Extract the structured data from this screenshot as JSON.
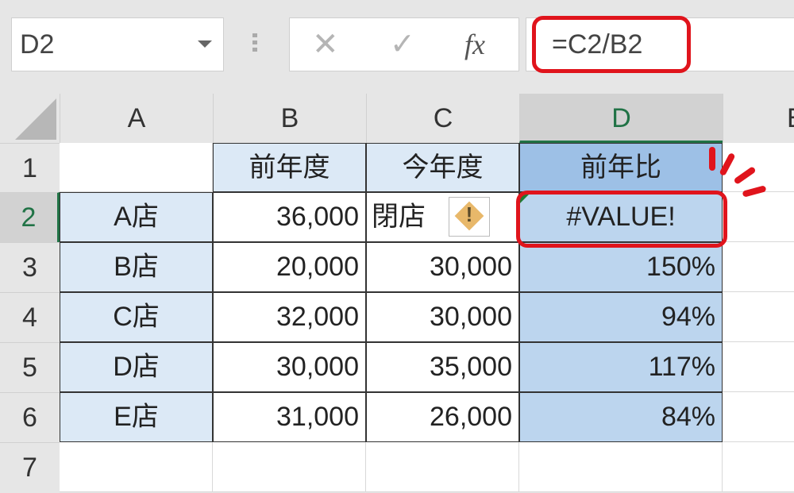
{
  "formula_bar": {
    "name_box": "D2",
    "cancel_icon": "✕",
    "enter_icon": "✓",
    "fx_label": "fx",
    "formula": "=C2/B2"
  },
  "columns": [
    "A",
    "B",
    "C",
    "D",
    "E"
  ],
  "rows": [
    "1",
    "2",
    "3",
    "4",
    "5",
    "6",
    "7"
  ],
  "selected_cell": "D2",
  "headers": {
    "B": "前年度",
    "C": "今年度",
    "D": "前年比"
  },
  "table": [
    {
      "store": "A店",
      "prev": "36,000",
      "curr": "閉店",
      "ratio": "#VALUE!"
    },
    {
      "store": "B店",
      "prev": "20,000",
      "curr": "30,000",
      "ratio": "150%"
    },
    {
      "store": "C店",
      "prev": "32,000",
      "curr": "30,000",
      "ratio": "94%"
    },
    {
      "store": "D店",
      "prev": "30,000",
      "curr": "35,000",
      "ratio": "117%"
    },
    {
      "store": "E店",
      "prev": "31,000",
      "curr": "26,000",
      "ratio": "84%"
    }
  ],
  "error_indicator": {
    "icon": "warning-icon",
    "glyph": "!"
  },
  "colors": {
    "highlight": "#e0141c",
    "selection_green": "#217346",
    "error_cell": "#bcd5ee"
  }
}
